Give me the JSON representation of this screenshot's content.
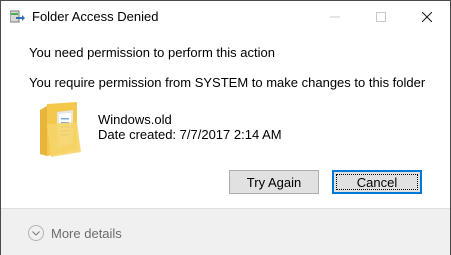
{
  "window": {
    "title": "Folder Access Denied"
  },
  "message": {
    "heading": "You need permission to perform this action",
    "detail": "You require permission from SYSTEM to make changes to this folder"
  },
  "item": {
    "name": "Windows.old",
    "date_created": "Date created: 7/7/2017 2:14 AM"
  },
  "buttons": {
    "try_again": "Try Again",
    "cancel": "Cancel"
  },
  "footer": {
    "more_details": "More details"
  },
  "colors": {
    "accent": "#0078d7",
    "folder": "#f3c84b",
    "footer_bg": "#f0f0f0"
  },
  "icons": {
    "title": "folder-move-icon",
    "item": "folder-icon",
    "footer": "chevron-down-icon"
  }
}
